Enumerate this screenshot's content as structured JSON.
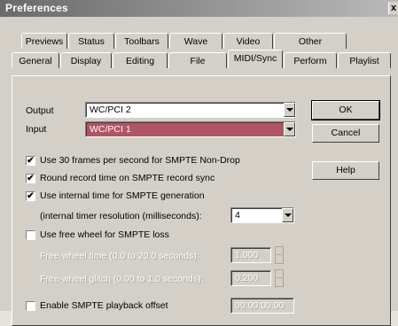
{
  "window": {
    "title": "Preferences",
    "close_glyph": "x"
  },
  "tabs_back": [
    "Previews",
    "Status",
    "Toolbars",
    "Wave",
    "Video",
    "Other"
  ],
  "tabs_front": [
    "General",
    "Display",
    "Editing",
    "File",
    "MIDI/Sync",
    "Perform",
    "Playlist"
  ],
  "active_tab": "MIDI/Sync",
  "output": {
    "label": "Output",
    "value": "WC/PCI 2"
  },
  "input": {
    "label": "Input",
    "value": "WC/PCI 1"
  },
  "buttons": {
    "ok": "OK",
    "cancel": "Cancel",
    "help": "Help"
  },
  "options": {
    "use30": {
      "label": "Use 30 frames per second for SMPTE Non-Drop",
      "checked": true,
      "mark": "✔"
    },
    "round": {
      "label": "Round record time on SMPTE record sync",
      "checked": true,
      "mark": "✔"
    },
    "internal": {
      "label": "Use internal time for SMPTE generation",
      "checked": true,
      "mark": "✔"
    },
    "resolution_label": "(internal timer resolution (milliseconds):",
    "resolution_value": "4",
    "freewheel": {
      "label": "Use free wheel for SMPTE loss",
      "checked": false,
      "mark": ""
    },
    "freewheel_time_label": "Free-wheel time (0.0 to 20.0 seconds):",
    "freewheel_time_value": "1.000",
    "freewheel_glitch_label": "Free-wheel glitch (0.00 to 1.0 seconds):",
    "freewheel_glitch_value": "0.200",
    "offset": {
      "label": "Enable SMPTE playback offset",
      "checked": false,
      "mark": "",
      "value": "00:00:00.00"
    }
  }
}
